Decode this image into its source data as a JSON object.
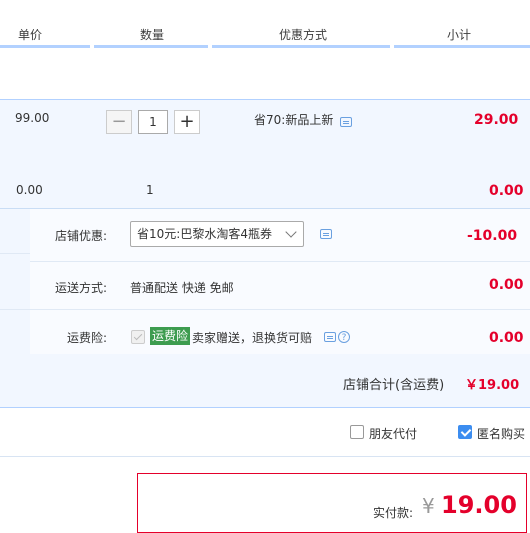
{
  "header": {
    "col_price": "单价",
    "col_qty": "数量",
    "col_promo": "优惠方式",
    "col_subtotal": "小计"
  },
  "item": {
    "price": "99.00",
    "quantity": "1",
    "promo": "省70:新品上新",
    "subtotal": "29.00",
    "minus": "−",
    "plus": "+"
  },
  "gift_row": {
    "price": "0.00",
    "quantity": "1",
    "subtotal": "0.00"
  },
  "shop": {
    "discount_label": "店铺优惠:",
    "discount_select": "省10元:巴黎水淘客4瓶券",
    "discount_value": "-10.00",
    "shipping_label": "运送方式:",
    "shipping_value": "普通配送 快递 免邮",
    "shipping_cost": "0.00",
    "insurance_label": "运费险:",
    "insurance_tag": "运费险",
    "insurance_desc": "卖家赠送，退换货可赔",
    "insurance_cost": "0.00",
    "total_label": "店铺合计(含运费)",
    "total_value": "￥19.00"
  },
  "options": {
    "friend_pay": "朋友代付",
    "anonymous": "匿名购买"
  },
  "payment": {
    "label": "实付款:",
    "currency": "¥",
    "amount": "19.00"
  },
  "colors": {
    "accent": "#e4002b",
    "link": "#3c8df0",
    "panel": "#f2f7ff"
  }
}
